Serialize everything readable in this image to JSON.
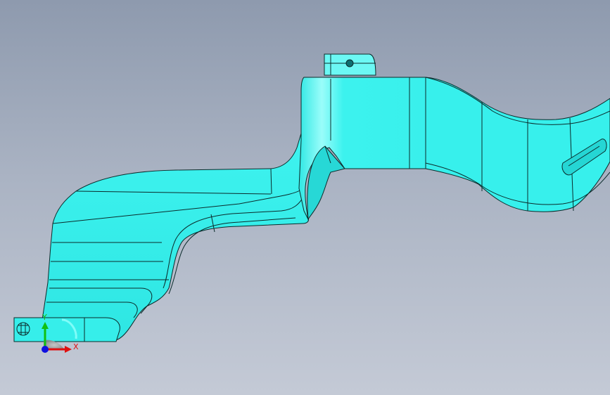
{
  "viewport": {
    "background_top": "#8e9aae",
    "background_bottom": "#c4cad6"
  },
  "model": {
    "face_color": "#33f0ec",
    "highlight_color": "#8dfcf8",
    "shadow_color": "#1fcfcf",
    "edge_color": "#0b2b2b"
  },
  "triad": {
    "x_label": "X",
    "y_label": "Y",
    "x_color": "#e01010",
    "y_color": "#10c010",
    "z_color": "#1010e0"
  }
}
